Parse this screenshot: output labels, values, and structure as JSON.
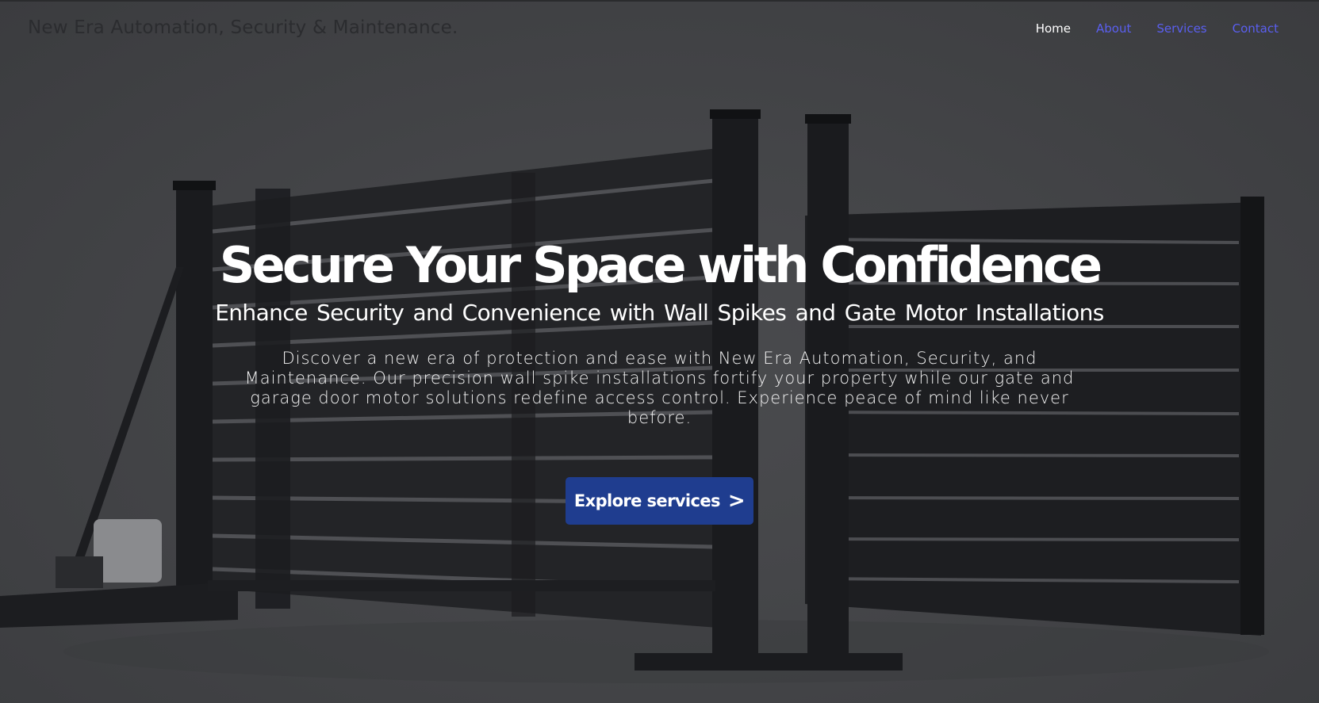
{
  "header": {
    "brand": "New Era Automation, Security & Maintenance."
  },
  "nav": {
    "items": [
      {
        "label": "Home",
        "active": true
      },
      {
        "label": "About",
        "active": false
      },
      {
        "label": "Services",
        "active": false
      },
      {
        "label": "Contact",
        "active": false
      }
    ]
  },
  "hero": {
    "title": "Secure Your Space with Confidence",
    "subtitle": "Enhance Security and Convenience with Wall Spikes and Gate Motor Installations",
    "body": "Discover a new era of protection and ease with New Era Automation, Security, and Maintenance. Our precision wall spike installations fortify your property while our gate  and garage door motor solutions redefine access control. Experience peace of mind like never before.",
    "cta_label": "Explore services",
    "cta_icon": "chevron-right-icon"
  },
  "colors": {
    "background": "#444548",
    "brand_text": "#2b2c2f",
    "nav_link": "#5a5ff0",
    "nav_active": "#ffffff",
    "cta_background": "#1f3d8f",
    "gate": "#1e1f22"
  }
}
